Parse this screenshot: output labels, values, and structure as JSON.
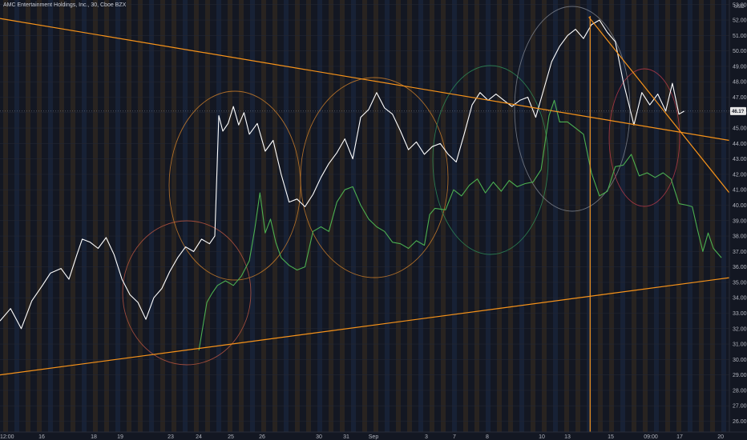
{
  "header": {
    "symbol_title": "AMC Entertainment Holdings, Inc., 30, Cboe BZX"
  },
  "price_axis": {
    "currency": "USD",
    "labels": [
      "53.00",
      "52.00",
      "51.00",
      "50.00",
      "49.00",
      "48.00",
      "47.00",
      "46.00",
      "45.00",
      "44.00",
      "43.00",
      "42.00",
      "41.00",
      "40.00",
      "39.00",
      "38.00",
      "37.00",
      "36.00",
      "35.00",
      "34.00",
      "33.00",
      "32.00",
      "31.00",
      "30.00",
      "29.00",
      "28.00",
      "27.00",
      "26.00"
    ],
    "current_price_label": "46.1?"
  },
  "time_axis": {
    "labels": [
      "12:00",
      "16",
      "18",
      "19",
      "23",
      "24",
      "25",
      "26",
      "30",
      "31",
      "Sep",
      "3",
      "7",
      "8",
      "10",
      "13",
      "15",
      "09:00",
      "17",
      "20"
    ]
  },
  "colors": {
    "background": "#131722",
    "price_line": "#ffffff",
    "comparison_line": "#4caf50",
    "trendline": "#f7931a",
    "session_band_orange": "#3a2e1f",
    "session_band_blue": "#1c2a46",
    "circle_brown": "#b5543f",
    "circle_orange": "#c77b2a",
    "circle_green": "#2e8b57",
    "circle_gray": "#7a7f8a",
    "circle_red": "#b23a48",
    "price_tag": "#e6e6e6"
  },
  "chart_data": {
    "type": "line",
    "title": "AMC Entertainment Holdings, Inc., 30, Cboe BZX",
    "xlabel": "",
    "ylabel": "USD",
    "ylim": [
      25.3,
      53.3
    ],
    "grid": true,
    "x_categories": [
      "12:00",
      "16",
      "18",
      "19",
      "23",
      "24",
      "25",
      "26",
      "30",
      "31",
      "Sep",
      "3",
      "7",
      "8",
      "10",
      "13",
      "15",
      "09:00",
      "17",
      "20"
    ],
    "series": [
      {
        "role": "price",
        "points": [
          [
            0,
            32.5
          ],
          [
            0.4,
            33.3
          ],
          [
            0.8,
            32.0
          ],
          [
            1.2,
            33.8
          ],
          [
            1.6,
            34.8
          ],
          [
            1.9,
            35.6
          ],
          [
            2.3,
            35.9
          ],
          [
            2.6,
            35.2
          ],
          [
            2.9,
            36.8
          ],
          [
            3.1,
            37.8
          ],
          [
            3.4,
            37.6
          ],
          [
            3.7,
            37.2
          ],
          [
            4.0,
            37.9
          ],
          [
            4.3,
            36.8
          ],
          [
            4.6,
            35.2
          ],
          [
            4.9,
            34.2
          ],
          [
            5.2,
            33.7
          ],
          [
            5.5,
            32.6
          ],
          [
            5.8,
            34.0
          ],
          [
            6.1,
            34.6
          ],
          [
            6.4,
            35.7
          ],
          [
            6.7,
            36.6
          ],
          [
            7.0,
            37.3
          ],
          [
            7.3,
            37.0
          ],
          [
            7.6,
            37.8
          ],
          [
            7.9,
            37.5
          ],
          [
            8.1,
            38.0
          ],
          [
            8.25,
            45.8
          ],
          [
            8.4,
            44.8
          ],
          [
            8.6,
            45.3
          ],
          [
            8.8,
            46.4
          ],
          [
            9.0,
            45.2
          ],
          [
            9.2,
            46.0
          ],
          [
            9.4,
            44.6
          ],
          [
            9.7,
            45.3
          ],
          [
            10.0,
            43.5
          ],
          [
            10.3,
            44.2
          ],
          [
            10.6,
            42.0
          ],
          [
            10.9,
            40.2
          ],
          [
            11.2,
            40.4
          ],
          [
            11.5,
            39.9
          ],
          [
            11.8,
            40.7
          ],
          [
            12.1,
            41.8
          ],
          [
            12.4,
            42.7
          ],
          [
            12.7,
            43.4
          ],
          [
            13.0,
            44.3
          ],
          [
            13.3,
            43.0
          ],
          [
            13.6,
            45.7
          ],
          [
            13.9,
            46.2
          ],
          [
            14.2,
            47.3
          ],
          [
            14.5,
            46.3
          ],
          [
            14.8,
            45.9
          ],
          [
            15.1,
            44.8
          ],
          [
            15.4,
            43.6
          ],
          [
            15.7,
            44.1
          ],
          [
            16.0,
            43.3
          ],
          [
            16.3,
            43.8
          ],
          [
            16.6,
            44.0
          ],
          [
            16.9,
            43.3
          ],
          [
            17.2,
            42.8
          ],
          [
            17.5,
            44.6
          ],
          [
            17.8,
            46.5
          ],
          [
            18.1,
            47.3
          ],
          [
            18.4,
            46.8
          ],
          [
            18.7,
            47.2
          ],
          [
            19.0,
            46.8
          ],
          [
            19.3,
            46.4
          ],
          [
            19.6,
            46.8
          ],
          [
            19.9,
            47.0
          ],
          [
            20.2,
            45.7
          ],
          [
            20.5,
            47.5
          ],
          [
            20.8,
            49.3
          ],
          [
            21.1,
            50.3
          ],
          [
            21.4,
            51.0
          ],
          [
            21.7,
            51.4
          ],
          [
            22.0,
            50.8
          ],
          [
            22.3,
            51.7
          ],
          [
            22.6,
            52.0
          ],
          [
            22.9,
            51.2
          ],
          [
            23.2,
            50.6
          ],
          [
            23.5,
            48.0
          ],
          [
            23.7,
            46.6
          ],
          [
            23.9,
            45.2
          ],
          [
            24.2,
            47.3
          ],
          [
            24.5,
            46.5
          ],
          [
            24.8,
            47.2
          ],
          [
            25.1,
            46.1
          ],
          [
            25.35,
            47.9
          ],
          [
            25.6,
            45.9
          ],
          [
            25.8,
            46.1
          ]
        ]
      },
      {
        "role": "comparison",
        "points": [
          [
            7.5,
            30.6
          ],
          [
            7.8,
            33.7
          ],
          [
            8.0,
            34.3
          ],
          [
            8.2,
            34.8
          ],
          [
            8.5,
            35.1
          ],
          [
            8.8,
            34.8
          ],
          [
            9.1,
            35.4
          ],
          [
            9.4,
            36.4
          ],
          [
            9.6,
            38.4
          ],
          [
            9.8,
            40.8
          ],
          [
            10.0,
            38.2
          ],
          [
            10.2,
            39.1
          ],
          [
            10.4,
            37.6
          ],
          [
            10.6,
            36.6
          ],
          [
            10.9,
            36.1
          ],
          [
            11.2,
            35.8
          ],
          [
            11.5,
            36.0
          ],
          [
            11.8,
            38.3
          ],
          [
            12.1,
            38.6
          ],
          [
            12.4,
            38.3
          ],
          [
            12.7,
            40.2
          ],
          [
            13.0,
            41.0
          ],
          [
            13.3,
            41.2
          ],
          [
            13.6,
            40.0
          ],
          [
            13.9,
            39.1
          ],
          [
            14.2,
            38.6
          ],
          [
            14.5,
            38.3
          ],
          [
            14.8,
            37.6
          ],
          [
            15.1,
            37.5
          ],
          [
            15.4,
            37.2
          ],
          [
            15.7,
            37.7
          ],
          [
            16.0,
            37.4
          ],
          [
            16.2,
            39.4
          ],
          [
            16.4,
            39.8
          ],
          [
            16.8,
            39.7
          ],
          [
            17.1,
            41.0
          ],
          [
            17.4,
            40.6
          ],
          [
            17.7,
            41.3
          ],
          [
            18.0,
            41.7
          ],
          [
            18.3,
            40.8
          ],
          [
            18.6,
            41.5
          ],
          [
            18.9,
            40.9
          ],
          [
            19.2,
            41.6
          ],
          [
            19.5,
            41.2
          ],
          [
            19.8,
            41.4
          ],
          [
            20.1,
            41.5
          ],
          [
            20.4,
            42.3
          ],
          [
            20.7,
            45.8
          ],
          [
            20.9,
            46.8
          ],
          [
            21.1,
            45.4
          ],
          [
            21.4,
            45.4
          ],
          [
            21.7,
            45.0
          ],
          [
            22.0,
            44.6
          ],
          [
            22.3,
            42.1
          ],
          [
            22.6,
            40.6
          ],
          [
            22.9,
            40.9
          ],
          [
            23.2,
            42.5
          ],
          [
            23.5,
            42.6
          ],
          [
            23.8,
            43.3
          ],
          [
            24.1,
            41.9
          ],
          [
            24.4,
            42.1
          ],
          [
            24.7,
            41.8
          ],
          [
            25.0,
            42.1
          ],
          [
            25.3,
            41.7
          ],
          [
            25.6,
            40.1
          ],
          [
            25.9,
            40.0
          ],
          [
            26.1,
            39.9
          ],
          [
            26.3,
            38.4
          ],
          [
            26.5,
            37.0
          ],
          [
            26.7,
            38.2
          ],
          [
            26.9,
            37.2
          ],
          [
            27.2,
            36.6
          ]
        ]
      }
    ],
    "reference_lines": [
      {
        "kind": "trendline",
        "from": [
          0,
          52.1
        ],
        "to": [
          27.5,
          44.2
        ]
      },
      {
        "kind": "trendline",
        "from": [
          0,
          29.0
        ],
        "to": [
          27.5,
          35.3
        ]
      },
      {
        "kind": "trendline",
        "from": [
          22.2,
          52.2
        ],
        "to": [
          27.5,
          40.8
        ]
      },
      {
        "kind": "vertical",
        "at": 22.25
      }
    ],
    "current_price": 46.1
  }
}
